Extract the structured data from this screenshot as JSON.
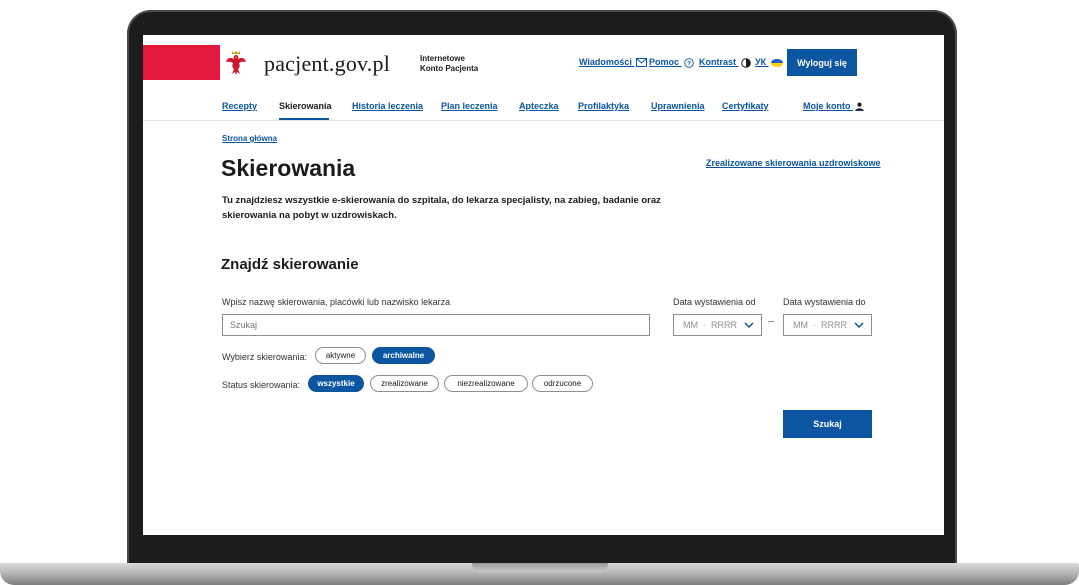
{
  "header": {
    "site_name": "pacjent.gov.pl",
    "subtitle_line1": "Internetowe",
    "subtitle_line2": "Konto Pacjenta",
    "links": {
      "messages": "Wiadomości",
      "help": "Pomoc",
      "contrast": "Kontrast",
      "language": "УК"
    },
    "logout_label": "Wyloguj się",
    "brand_color": "#e4173e",
    "accent_color": "#0b55a1"
  },
  "nav": {
    "items": [
      "Recepty",
      "Skierowania",
      "Historia leczenia",
      "Plan leczenia",
      "Apteczka",
      "Profilaktyka",
      "Uprawnienia",
      "Certyfikaty"
    ],
    "active": "Skierowania",
    "account": "Moje konto"
  },
  "breadcrumb": "Strona główna",
  "page": {
    "title": "Skierowania",
    "uzdrowiskowe_link": "Zrealizowane skierowania uzdrowiskowe",
    "description": "Tu znajdziesz wszystkie e-skierowania do szpitala, do lekarza specjalisty, na zabieg, badanie oraz skierowania na pobyt w uzdrowiskach."
  },
  "search": {
    "section_title": "Znajdź skierowanie",
    "query_label": "Wpisz nazwę skierowania, placówki lub nazwisko lekarza",
    "query_placeholder": "Szukaj",
    "date_from_label": "Data wystawienia od",
    "date_to_label": "Data wystawienia do",
    "date_month_placeholder": "MM",
    "date_separator": "-",
    "date_year_placeholder": "RRRR",
    "type_label": "Wybierz skierowania:",
    "type_options": [
      "aktywne",
      "archiwalne"
    ],
    "type_selected": "archiwalne",
    "status_label": "Status skierowania:",
    "status_options": [
      "wszystkie",
      "zrealizowane",
      "niezrealizowane",
      "odrzucone"
    ],
    "status_selected": "wszystkie",
    "submit_label": "Szukaj"
  },
  "icons": {
    "emblem": "polish-eagle-icon",
    "messages": "envelope-icon",
    "help": "question-circle-icon",
    "contrast": "contrast-icon",
    "language": "ukraine-flag-icon",
    "account": "user-icon",
    "date_dropdown": "chevron-down-icon"
  }
}
